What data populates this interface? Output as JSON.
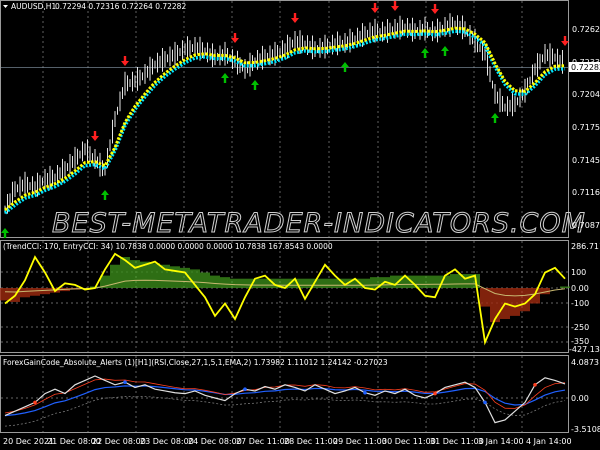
{
  "header": {
    "symbol": "AUDUSD,H1",
    "ohlc": "0.72294 0.72316 0.72264 0.72282"
  },
  "watermark": "BEST-METATRADER-INDICATORS.COM",
  "colors": {
    "background": "#000000",
    "candles": "#ffffff",
    "ma_yellow": "#ffff00",
    "ma_cyan": "#00e5ff",
    "arrow_up": "#00c000",
    "arrow_down": "#ff2020",
    "cci_line": "#ffff00",
    "hist_pos": "#3a8a1a",
    "hist_neg": "#a02a10",
    "osc_main": "#e0e0e0",
    "osc_signal": "#2060ff",
    "osc_red": "#ff4020"
  },
  "chart_data": [
    {
      "type": "line",
      "title": "AUDUSD,H1",
      "ylabel": "Price",
      "y_ticks": [
        "0.72625",
        "0.72335",
        "0.72040",
        "0.71750",
        "0.71455",
        "0.71165",
        "0.70870"
      ],
      "ylim": [
        0.7087,
        0.72625
      ],
      "current_price": "0.72282",
      "x_ticks": [
        "20 Dec 2021",
        "21 Dec 08:00",
        "22 Dec 08:00",
        "23 Dec 08:00",
        "24 Dec 08:00",
        "27 Dec 11:00",
        "28 Dec 11:00",
        "29 Dec 11:00",
        "30 Dec 11:00",
        "31 Dec 11:00",
        "3 Jan 14:00",
        "4 Jan 14:00"
      ],
      "close": [
        0.71005,
        0.71184,
        0.71229,
        0.71202,
        0.71273,
        0.71291,
        0.71363,
        0.71452,
        0.71542,
        0.71452,
        0.71345,
        0.71811,
        0.72124,
        0.72151,
        0.72213,
        0.72303,
        0.72348,
        0.72392,
        0.72437,
        0.72455,
        0.72419,
        0.72365,
        0.72392,
        0.7233,
        0.72258,
        0.7233,
        0.72365,
        0.72392,
        0.72437,
        0.72509,
        0.72482,
        0.72437,
        0.72455,
        0.72482,
        0.72491,
        0.72527,
        0.72571,
        0.72598,
        0.72589,
        0.72616,
        0.72634,
        0.72598,
        0.72616,
        0.72589,
        0.72634,
        0.72661,
        0.72616,
        0.72509,
        0.72392,
        0.72034,
        0.71918,
        0.71945,
        0.72061,
        0.72258,
        0.72392,
        0.72365,
        0.72303
      ],
      "signals_down": [
        9,
        12,
        23,
        29,
        37,
        39,
        43,
        56
      ],
      "signals_up": [
        0,
        10,
        22,
        25,
        34,
        42,
        44,
        49
      ]
    },
    {
      "type": "line",
      "title": "(TrendCCI: 170, EntryCCI: 34) 10.7838 0.0000 0.0000 0.0000 10.7838 167.8543 0.0000",
      "y_ticks": [
        "286.711",
        "100",
        "0.00",
        "-100",
        "-250",
        "-350",
        "-427.1375"
      ],
      "ylim": [
        -427.1375,
        286.711
      ],
      "cci": [
        -100,
        -50,
        50,
        200,
        100,
        -20,
        30,
        20,
        -10,
        0,
        120,
        220,
        180,
        130,
        150,
        170,
        120,
        110,
        100,
        20,
        -60,
        -180,
        -100,
        -200,
        -60,
        60,
        80,
        20,
        0,
        60,
        -70,
        40,
        150,
        80,
        20,
        60,
        0,
        -10,
        40,
        20,
        80,
        20,
        -50,
        -60,
        80,
        120,
        60,
        80,
        -350,
        -200,
        -100,
        -120,
        -100,
        -40,
        100,
        130,
        60
      ],
      "trend_hist": [
        -80,
        -90,
        -60,
        -50,
        -40,
        -30,
        -20,
        -10,
        -5,
        10,
        80,
        150,
        200,
        180,
        170,
        160,
        150,
        140,
        130,
        120,
        100,
        80,
        70,
        60,
        60,
        60,
        60,
        60,
        60,
        60,
        60,
        60,
        60,
        60,
        60,
        60,
        60,
        70,
        70,
        80,
        80,
        80,
        80,
        80,
        80,
        90,
        90,
        90,
        -120,
        -220,
        -200,
        -180,
        -150,
        -100,
        -40,
        0,
        10
      ]
    },
    {
      "type": "line",
      "title": "ForexGainCode_Absolute_Alerts (1)[H1](RSI,Close,27,1,5,1,EMA,2) 1.73982 1.11012 1.24142 -0.27023",
      "y_ticks": [
        "4.0873",
        "0.00",
        "-3.51084"
      ],
      "ylim": [
        -3.51084,
        4.0873
      ],
      "main": [
        -2,
        -1.5,
        -1,
        -0.5,
        0.5,
        1,
        0.5,
        1.5,
        2,
        2.5,
        2,
        1.5,
        1.8,
        1.2,
        1.5,
        1.0,
        0.8,
        0.6,
        0.5,
        0.8,
        0.3,
        0,
        -0.3,
        0.5,
        1,
        0.8,
        1.3,
        1.0,
        1.5,
        1.2,
        0.8,
        1.5,
        1.0,
        0.5,
        0.8,
        1.2,
        0.6,
        0.3,
        0.8,
        0.5,
        1.0,
        0.3,
        0,
        0.5,
        1.2,
        1.5,
        1.8,
        1.2,
        -0.5,
        -2.8,
        -2.5,
        -1.5,
        -0.5,
        1.5,
        2.3,
        2.0,
        1.6
      ]
    }
  ]
}
